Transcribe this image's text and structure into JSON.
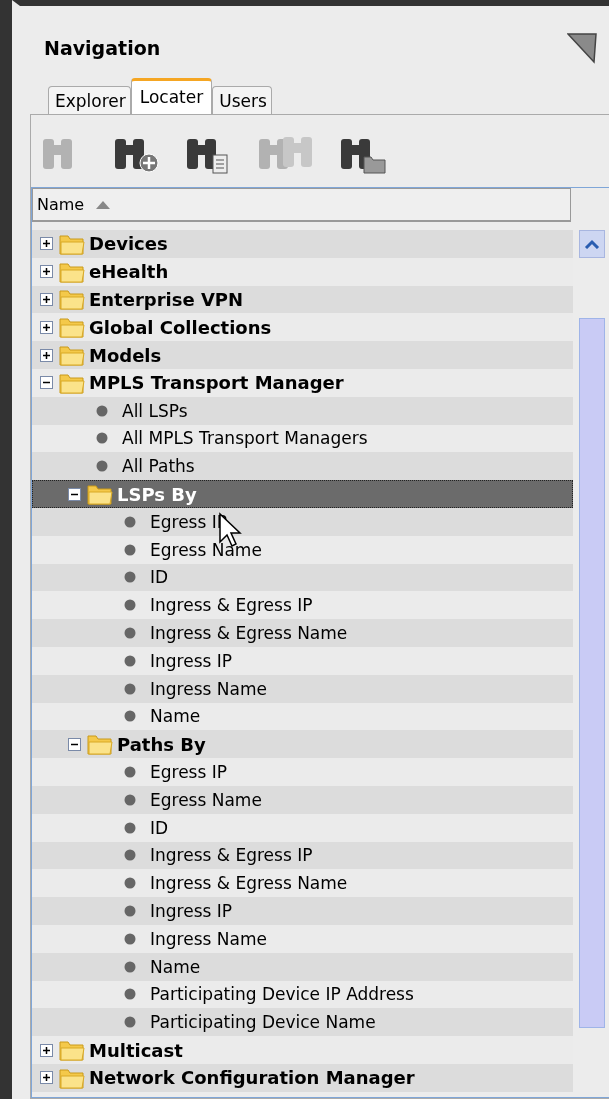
{
  "panel": {
    "title": "Navigation"
  },
  "tabs": [
    {
      "label": "Explorer",
      "selected": false
    },
    {
      "label": "Locater",
      "selected": true
    },
    {
      "label": "Users",
      "selected": false
    }
  ],
  "toolbar": [
    {
      "kind": "search",
      "disabled": true
    },
    {
      "kind": "add",
      "disabled": false
    },
    {
      "kind": "list",
      "disabled": false
    },
    {
      "kind": "multi",
      "disabled": true
    },
    {
      "kind": "folder",
      "disabled": false
    }
  ],
  "table": {
    "columns": [
      {
        "label": "Name",
        "sorted": true
      }
    ]
  },
  "tree": [
    {
      "kind": "folder",
      "label": "Devices",
      "expanded": false,
      "selected": false
    },
    {
      "kind": "folder",
      "label": "eHealth",
      "expanded": false,
      "selected": false
    },
    {
      "kind": "folder",
      "label": "Enterprise VPN",
      "expanded": false,
      "selected": false
    },
    {
      "kind": "folder",
      "label": "Global Collections",
      "expanded": false,
      "selected": false
    },
    {
      "kind": "folder",
      "label": "Models",
      "expanded": false,
      "selected": false
    },
    {
      "kind": "folder",
      "label": "MPLS Transport Manager",
      "expanded": true,
      "selected": false,
      "children": [
        {
          "kind": "leaf",
          "label": "All LSPs",
          "selected": false
        },
        {
          "kind": "leaf",
          "label": "All MPLS Transport Managers",
          "selected": false
        },
        {
          "kind": "leaf",
          "label": "All Paths",
          "selected": false
        },
        {
          "kind": "folder",
          "label": "LSPs By",
          "expanded": true,
          "selected": true,
          "children": [
            {
              "kind": "leaf",
              "label": "Egress IP",
              "selected": false
            },
            {
              "kind": "leaf",
              "label": "Egress Name",
              "selected": false
            },
            {
              "kind": "leaf",
              "label": "ID",
              "selected": false
            },
            {
              "kind": "leaf",
              "label": "Ingress & Egress IP",
              "selected": false
            },
            {
              "kind": "leaf",
              "label": "Ingress & Egress Name",
              "selected": false
            },
            {
              "kind": "leaf",
              "label": "Ingress IP",
              "selected": false
            },
            {
              "kind": "leaf",
              "label": "Ingress Name",
              "selected": false
            },
            {
              "kind": "leaf",
              "label": "Name",
              "selected": false
            }
          ]
        },
        {
          "kind": "folder",
          "label": "Paths By",
          "expanded": true,
          "selected": false,
          "children": [
            {
              "kind": "leaf",
              "label": "Egress IP",
              "selected": false
            },
            {
              "kind": "leaf",
              "label": "Egress Name",
              "selected": false
            },
            {
              "kind": "leaf",
              "label": "ID",
              "selected": false
            },
            {
              "kind": "leaf",
              "label": "Ingress & Egress IP",
              "selected": false
            },
            {
              "kind": "leaf",
              "label": "Ingress & Egress Name",
              "selected": false
            },
            {
              "kind": "leaf",
              "label": "Ingress IP",
              "selected": false
            },
            {
              "kind": "leaf",
              "label": "Ingress Name",
              "selected": false
            },
            {
              "kind": "leaf",
              "label": "Name",
              "selected": false
            },
            {
              "kind": "leaf",
              "label": "Participating Device IP Address",
              "selected": false
            },
            {
              "kind": "leaf",
              "label": "Participating Device Name",
              "selected": false
            }
          ]
        }
      ]
    },
    {
      "kind": "folder",
      "label": "Multicast",
      "expanded": false,
      "selected": false
    },
    {
      "kind": "folder",
      "label": "Network Configuration Manager",
      "expanded": false,
      "selected": false
    }
  ]
}
